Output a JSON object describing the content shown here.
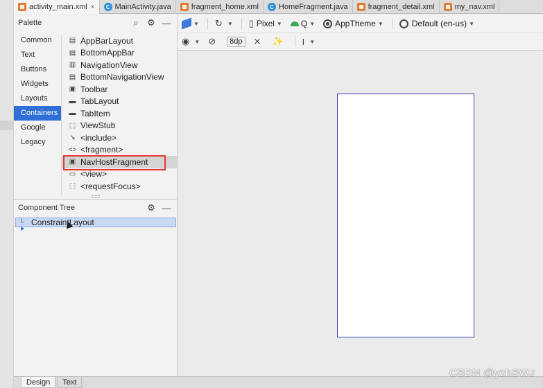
{
  "tabs": [
    {
      "label": "activity_main.xml",
      "kind": "xml",
      "active": true,
      "close": "×"
    },
    {
      "label": "MainActivity.java",
      "kind": "java",
      "active": false
    },
    {
      "label": "fragment_home.xml",
      "kind": "xml",
      "active": false
    },
    {
      "label": "HomeFragment.java",
      "kind": "java",
      "active": false
    },
    {
      "label": "fragment_detail.xml",
      "kind": "xml",
      "active": false
    },
    {
      "label": "my_nav.xml",
      "kind": "xml",
      "active": false
    }
  ],
  "palette": {
    "title": "Palette",
    "categories": [
      "Common",
      "Text",
      "Buttons",
      "Widgets",
      "Layouts",
      "Containers",
      "Google",
      "Legacy"
    ],
    "selected_category": "Containers",
    "items": [
      {
        "label": "AppBarLayout",
        "icon": "appbar-icon"
      },
      {
        "label": "BottomAppBar",
        "icon": "bottom-appbar-icon"
      },
      {
        "label": "NavigationView",
        "icon": "navigation-view-icon"
      },
      {
        "label": "BottomNavigationView",
        "icon": "bottom-navigation-icon"
      },
      {
        "label": "Toolbar",
        "icon": "toolbar-icon"
      },
      {
        "label": "TabLayout",
        "icon": "tab-layout-icon"
      },
      {
        "label": "TabItem",
        "icon": "tab-item-icon"
      },
      {
        "label": "ViewStub",
        "icon": "view-stub-icon"
      },
      {
        "label": "<include>",
        "icon": "include-icon"
      },
      {
        "label": "<fragment>",
        "icon": "fragment-icon"
      },
      {
        "label": "NavHostFragment",
        "icon": "nav-host-fragment-icon"
      },
      {
        "label": "<view>",
        "icon": "view-icon"
      },
      {
        "label": "<requestFocus>",
        "icon": "request-focus-icon"
      }
    ],
    "highlighted_item": "NavHostFragment",
    "highlight_color": "#e53935"
  },
  "component_tree": {
    "title": "Component Tree",
    "root": "ConstraintLayout"
  },
  "toolbar": {
    "device": "Pixel",
    "api": "Q",
    "theme": "AppTheme",
    "locale": "Default (en-us)",
    "margin": "8dp"
  },
  "bottom_tabs": [
    "Design",
    "Text"
  ],
  "active_bottom_tab": "Design",
  "watermark": "CSDN @yzhSWJ",
  "colors": {
    "accent": "#2f6fd6",
    "device_border": "#3b3bb0"
  }
}
